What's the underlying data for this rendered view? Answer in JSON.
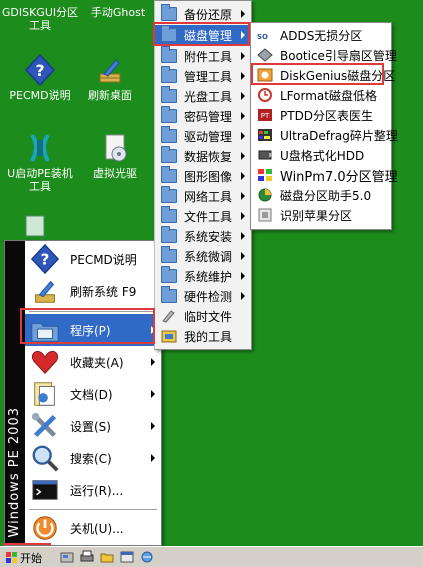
{
  "desktop": {
    "icons": [
      {
        "label": "GDISKGUI分区\n工具"
      },
      {
        "label": "手动Ghost"
      },
      {
        "label": "PECMD说明"
      },
      {
        "label": "刷新桌面"
      },
      {
        "label": "U启动PE装机\n工具"
      },
      {
        "label": "虚拟光驱"
      }
    ]
  },
  "start_menu": {
    "band_text": "Windows PE 2003",
    "items": [
      {
        "label": "PECMD说明",
        "icon": "help-icon"
      },
      {
        "label": "刷新系统 F9",
        "icon": "refresh-broom-icon"
      },
      {
        "label": "程序(P)",
        "icon": "programs-folder-icon"
      },
      {
        "label": "收藏夹(A)",
        "icon": "heart-icon"
      },
      {
        "label": "文档(D)",
        "icon": "documents-icon"
      },
      {
        "label": "设置(S)",
        "icon": "settings-tools-icon"
      },
      {
        "label": "搜索(C)",
        "icon": "search-icon"
      },
      {
        "label": "运行(R)...",
        "icon": "run-icon"
      },
      {
        "label": "关机(U)...",
        "icon": "shutdown-icon"
      }
    ]
  },
  "programs_menu": {
    "items": [
      {
        "label": "备份还原"
      },
      {
        "label": "磁盘管理"
      },
      {
        "label": "附件工具"
      },
      {
        "label": "管理工具"
      },
      {
        "label": "光盘工具"
      },
      {
        "label": "密码管理"
      },
      {
        "label": "驱动管理"
      },
      {
        "label": "数据恢复"
      },
      {
        "label": "图形图像"
      },
      {
        "label": "网络工具"
      },
      {
        "label": "文件工具"
      },
      {
        "label": "系统安装"
      },
      {
        "label": "系统微调"
      },
      {
        "label": "系统维护"
      },
      {
        "label": "硬件检测"
      },
      {
        "label": "临时文件"
      },
      {
        "label": "我的工具"
      }
    ]
  },
  "disk_menu": {
    "items": [
      {
        "label": "ADDS无损分区"
      },
      {
        "label": "Bootice引导扇区管理"
      },
      {
        "label": "DiskGenius磁盘分区"
      },
      {
        "label": "LFormat磁盘低格"
      },
      {
        "label": "PTDD分区表医生"
      },
      {
        "label": "UltraDefrag碎片整理"
      },
      {
        "label": "U盘格式化HDD"
      },
      {
        "label": "WinPm7.0分区管理"
      },
      {
        "label": "磁盘分区助手5.0"
      },
      {
        "label": "识别苹果分区"
      }
    ]
  },
  "taskbar": {
    "start_label": "开始"
  },
  "colors": {
    "desktop": "#1c8c1c",
    "selection": "#3169c6",
    "highlight": "#e0393b"
  }
}
